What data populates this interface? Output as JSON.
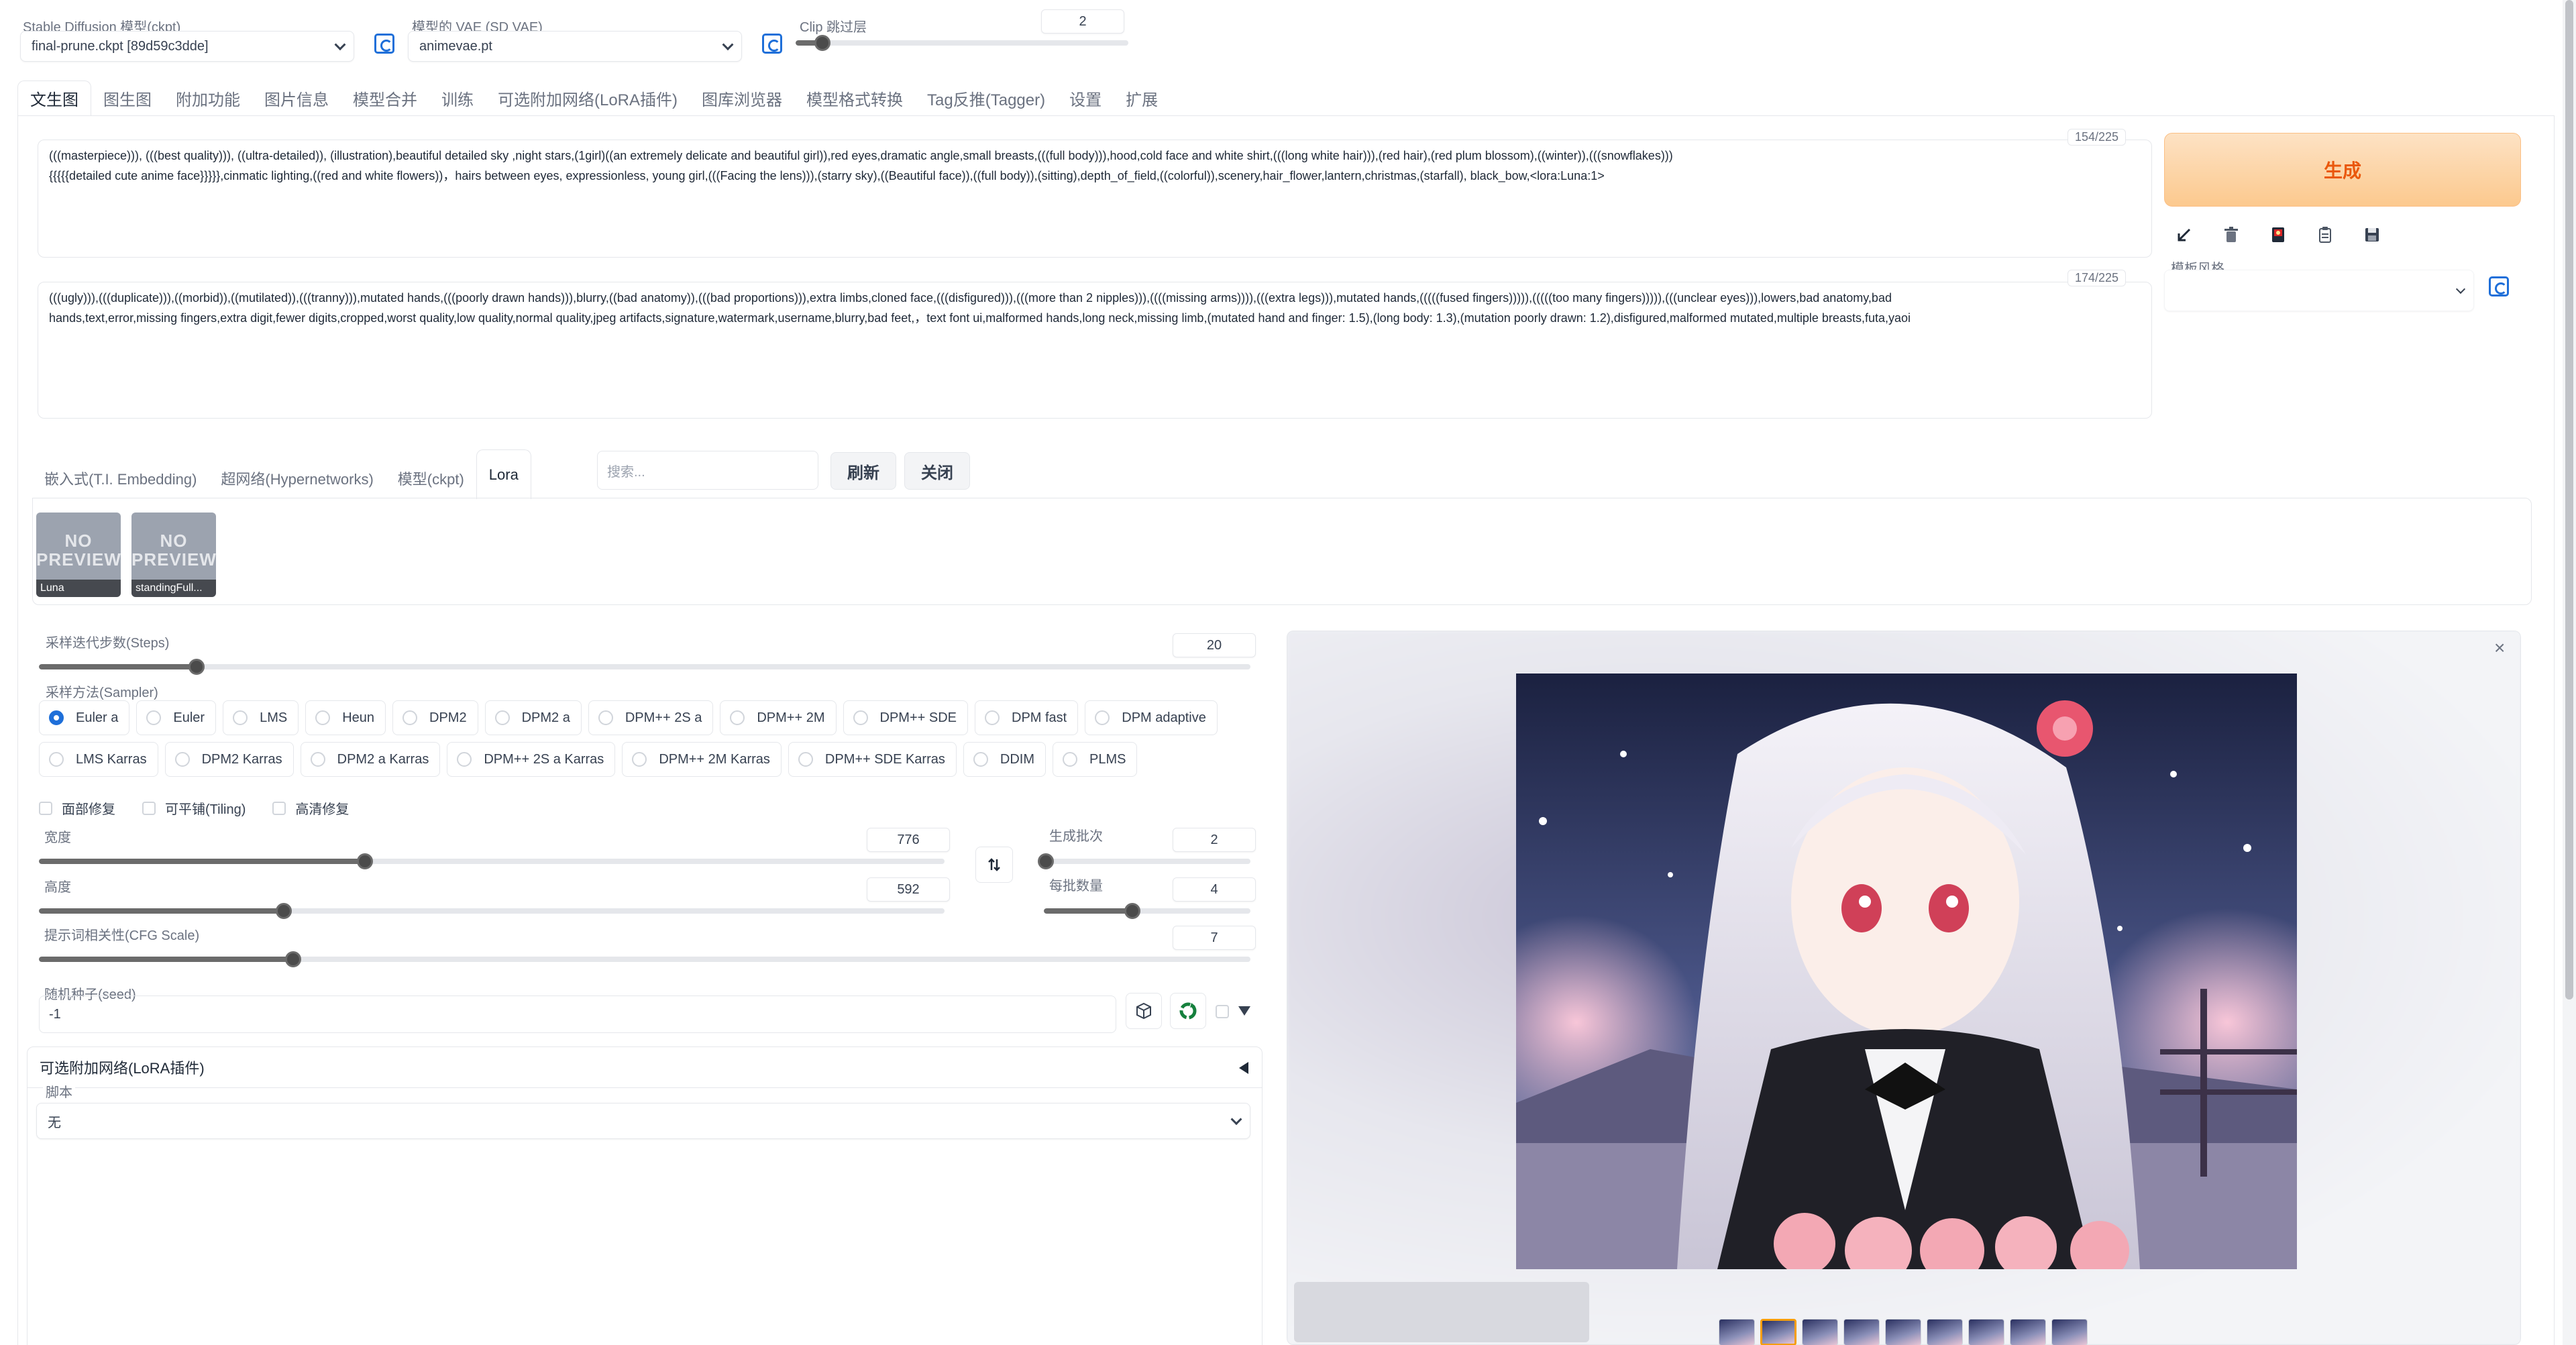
{
  "header": {
    "ckpt_label": "Stable Diffusion 模型(ckpt)",
    "ckpt_value": "final-prune.ckpt [89d59c3dde]",
    "vae_label": "模型的 VAE (SD VAE)",
    "vae_value": "animevae.pt",
    "clip_label": "Clip 跳过层",
    "clip_value": "2",
    "clip_fraction": 0.08
  },
  "tabs": [
    "文生图",
    "图生图",
    "附加功能",
    "图片信息",
    "模型合并",
    "训练",
    "可选附加网络(LoRA插件)",
    "图库浏览器",
    "模型格式转换",
    "Tag反推(Tagger)",
    "设置",
    "扩展"
  ],
  "prompt": {
    "counter": "154/225",
    "line1": "(((masterpiece))), (((best quality))), ((ultra-detailed)), (illustration),beautiful detailed sky ,night stars,(1girl)((an extremely delicate and beautiful girl)),red eyes,dramatic angle,small breasts,(((full body))),hood,cold face and white shirt,(((long white hair))),(red hair),(red plum blossom),((winter)),(((snowflakes)))",
    "line2": "{{{{{detailed cute anime face}}}}},cinmatic lighting,((red and white flowers))，hairs between eyes, expressionless, young girl,(((Facing the lens))),(starry sky),((Beautiful face)),((full body)),(sitting),depth_of_field,((colorful)),scenery,hair_flower,lantern,christmas,(starfall), black_bow,<lora:Luna:1>"
  },
  "negative": {
    "counter": "174/225",
    "line1": "(((ugly))),(((duplicate))),((morbid)),((mutilated)),(((tranny))),mutated hands,(((poorly drawn hands))),blurry,((bad anatomy)),(((bad proportions))),extra limbs,cloned face,(((disfigured))),(((more than 2 nipples))),((((missing arms)))),(((extra legs))),mutated hands,(((((fused fingers))))),(((((too many fingers))))),(((unclear eyes))),lowers,bad anatomy,bad",
    "line2": "hands,text,error,missing fingers,extra digit,fewer digits,cropped,worst quality,low quality,normal quality,jpeg artifacts,signature,watermark,username,blurry,bad feet,，text font ui,malformed hands,long neck,missing limb,(mutated hand and finger: 1.5),(long body: 1.3),(mutation poorly drawn: 1.2),disfigured,malformed mutated,multiple breasts,futa,yaoi"
  },
  "right": {
    "generate": "生成",
    "style_label": "模板风格",
    "tool_icons": [
      "arrow-icon",
      "trash-icon",
      "red-card-icon",
      "clipboard-icon",
      "save-icon"
    ]
  },
  "extra_tabs": [
    "嵌入式(T.I. Embedding)",
    "超网络(Hypernetworks)",
    "模型(ckpt)",
    "Lora"
  ],
  "extra": {
    "search_placeholder": "搜索...",
    "refresh": "刷新",
    "close": "关闭",
    "cards": [
      {
        "preview": "NO PREVIEW",
        "name": "Luna"
      },
      {
        "preview": "NO PREVIEW",
        "name": "standingFull..."
      }
    ]
  },
  "params": {
    "steps_label": "采样迭代步数(Steps)",
    "steps_value": "20",
    "steps_fraction": 0.13,
    "sampler_label": "采样方法(Sampler)",
    "samplers_row1": [
      "Euler a",
      "Euler",
      "LMS",
      "Heun",
      "DPM2",
      "DPM2 a",
      "DPM++ 2S a",
      "DPM++ 2M",
      "DPM++ SDE",
      "DPM fast",
      "DPM adaptive"
    ],
    "samplers_row2": [
      "LMS Karras",
      "DPM2 Karras",
      "DPM2 a Karras",
      "DPM++ 2S a Karras",
      "DPM++ 2M Karras",
      "DPM++ SDE Karras",
      "DDIM",
      "PLMS"
    ],
    "selected_sampler": "Euler a",
    "checkboxes": [
      "面部修复",
      "可平铺(Tiling)",
      "高清修复"
    ],
    "width_label": "宽度",
    "width_value": "776",
    "width_fraction": 0.36,
    "height_label": "高度",
    "height_value": "592",
    "height_fraction": 0.27,
    "swap_icon": "swap-arrows-icon",
    "batch_count_label": "生成批次",
    "batch_count_value": "2",
    "batch_count_fraction": 0.01,
    "batch_size_label": "每批数量",
    "batch_size_value": "4",
    "batch_size_fraction": 0.43,
    "cfg_label": "提示词相关性(CFG Scale)",
    "cfg_value": "7",
    "cfg_fraction": 0.21,
    "seed_label": "随机种子(seed)",
    "seed_value": "-1",
    "lora_panel_label": "可选附加网络(LoRA插件)",
    "script_label": "脚本",
    "script_value": "无"
  },
  "colors": {
    "accent": "#1e6fd9",
    "generate_bg": "#fdd8b0",
    "generate_text": "#ea580c",
    "track": "#e5e7eb",
    "track_fill": "#6b6b6b"
  }
}
